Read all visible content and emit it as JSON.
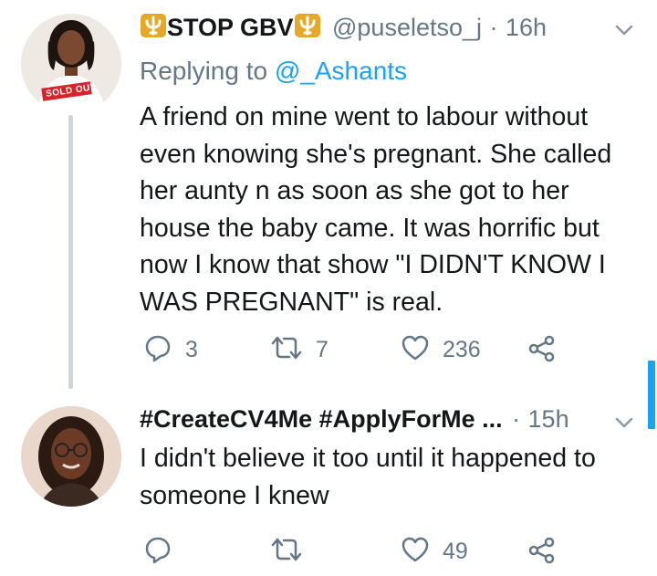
{
  "colors": {
    "accent": "#1da1f2",
    "muted": "#657786",
    "badge": "#e5a829"
  },
  "tweets": [
    {
      "display_name": "STOP GBV",
      "name_icon": "trident-emoji",
      "handle": "@puseletso_j",
      "separator": "·",
      "time": "16h",
      "replying_prefix": "Replying to",
      "replying_to": "@_Ashants",
      "avatar_text": "SOLD OUT",
      "lines": [
        "A friend on mine went to labour without",
        "even knowing she's pregnant. She called",
        "her aunty n as soon as she got to her",
        "house the baby came. It was horrific but",
        "now I know that show \"I DIDN'T KNOW I",
        "WAS PREGNANT\" is real."
      ],
      "replies": "3",
      "retweets": "7",
      "likes": "236"
    },
    {
      "display_name": "#CreateCV4Me #ApplyForMe ...",
      "separator": "·",
      "time": "15h",
      "lines": [
        "I didn't believe it too until it happened to",
        "someone I knew"
      ],
      "likes": "49"
    }
  ]
}
